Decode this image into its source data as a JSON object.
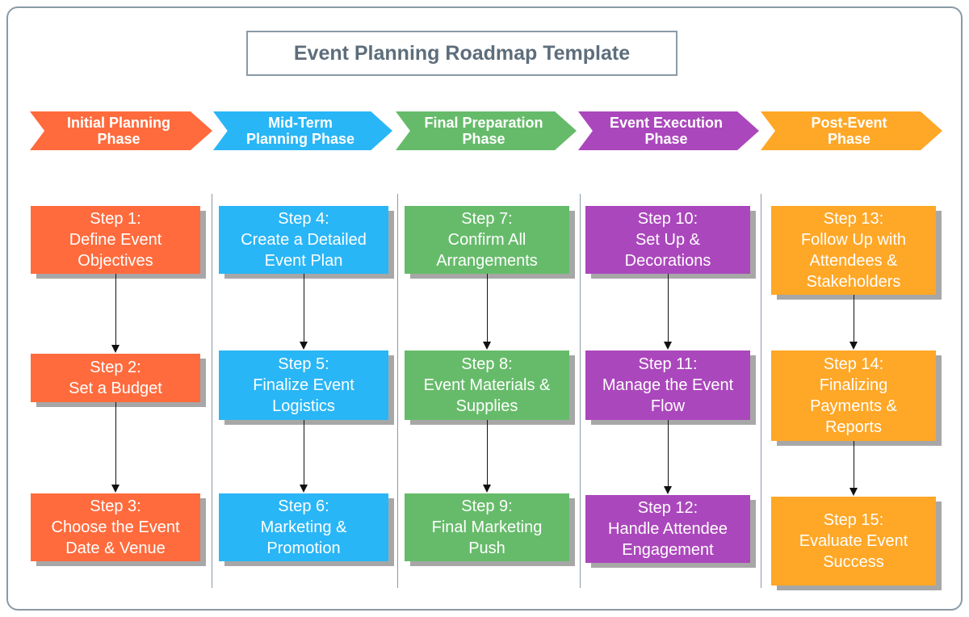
{
  "title": "Event Planning Roadmap Template",
  "colors": {
    "initial": "#ff6b3d",
    "midterm": "#29b6f6",
    "final": "#66bb6a",
    "execution": "#ab47bc",
    "post": "#ffa726",
    "border": "#8a9aa6"
  },
  "phases": [
    {
      "label": "Initial Planning\nPhase"
    },
    {
      "label": "Mid-Term\nPlanning Phase"
    },
    {
      "label": "Final Preparation\nPhase"
    },
    {
      "label": "Event Execution\nPhase"
    },
    {
      "label": "Post-Event\nPhase"
    }
  ],
  "steps": [
    {
      "label": "Step 1:\nDefine Event\nObjectives"
    },
    {
      "label": "Step 2:\nSet a Budget"
    },
    {
      "label": "Step 3:\nChoose the Event\nDate & Venue"
    },
    {
      "label": "Step 4:\nCreate a Detailed\nEvent Plan"
    },
    {
      "label": "Step 5:\nFinalize Event\nLogistics"
    },
    {
      "label": "Step 6:\nMarketing &\nPromotion"
    },
    {
      "label": "Step 7:\nConfirm All\nArrangements"
    },
    {
      "label": "Step 8:\nEvent Materials &\nSupplies"
    },
    {
      "label": "Step 9:\nFinal Marketing\nPush"
    },
    {
      "label": "Step 10:\nSet Up &\nDecorations"
    },
    {
      "label": "Step 11:\nManage the Event\nFlow"
    },
    {
      "label": "Step 12:\nHandle Attendee\nEngagement"
    },
    {
      "label": "Step 13:\nFollow Up with\nAttendees &\nStakeholders"
    },
    {
      "label": "Step 14:\nFinalizing\nPayments &\nReports"
    },
    {
      "label": "Step 15:\nEvaluate Event\nSuccess"
    }
  ]
}
